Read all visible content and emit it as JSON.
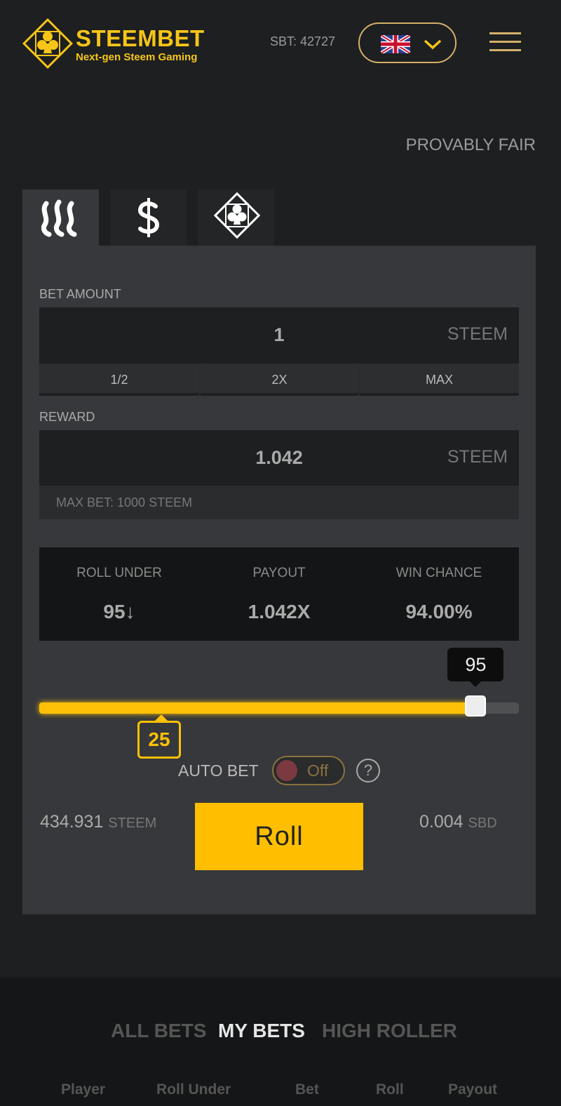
{
  "header": {
    "brand_name": "STEEMBET",
    "brand_tagline": "Next-gen Steem Gaming",
    "sbt_balance": "SBT: 42727",
    "language": "English",
    "flag_icon": "uk-flag-icon"
  },
  "provably_fair": "PROVABLY FAIR",
  "currency_tabs": [
    {
      "icon": "steem-icon",
      "active": true
    },
    {
      "icon": "sbd-dollar-icon",
      "active": false
    },
    {
      "icon": "club-diamond-icon",
      "active": false
    }
  ],
  "bet": {
    "label": "BET AMOUNT",
    "value": "1",
    "unit": "STEEM",
    "half": "1/2",
    "double": "2X",
    "max": "MAX"
  },
  "reward": {
    "label": "REWARD",
    "value": "1.042",
    "unit": "STEEM",
    "max_bet": "MAX BET: 1000 STEEM"
  },
  "stats": {
    "roll_under_label": "ROLL UNDER",
    "roll_under_value": "95↓",
    "payout_label": "PAYOUT",
    "payout_value": "1.042X",
    "win_chance_label": "WIN CHANCE",
    "win_chance_value": "94.00%"
  },
  "slider": {
    "value": "95",
    "min_value": "25",
    "fill_fraction": 0.91,
    "min_fraction": 0.25
  },
  "auto_bet": {
    "label": "AUTO BET",
    "state": "Off",
    "help": "?"
  },
  "balances": {
    "steem_value": "434.931",
    "steem_unit": "STEEM",
    "sbd_value": "0.004",
    "sbd_unit": "SBD"
  },
  "roll_button": "Roll",
  "colors": {
    "accent": "#ffc107",
    "background": "#1d1f21",
    "panel": "#36383b"
  },
  "bets_tabs": {
    "all": "ALL BETS",
    "mine": "MY BETS",
    "high_roller": "HIGH ROLLER"
  },
  "bets_columns": [
    "Player",
    "Roll Under",
    "Bet",
    "Roll",
    "Payout"
  ]
}
